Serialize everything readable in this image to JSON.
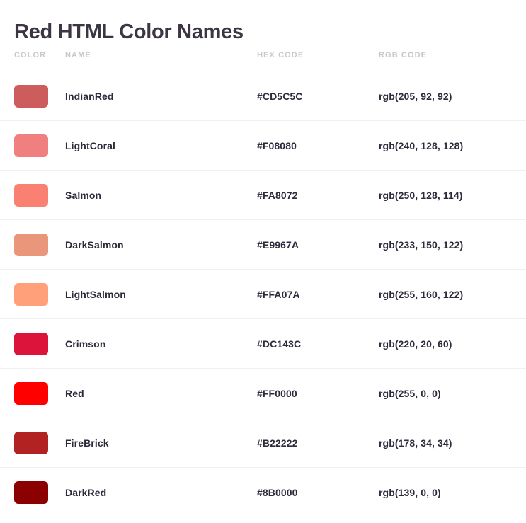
{
  "page": {
    "title": "Red HTML Color Names",
    "background": "#ffffff",
    "title_color": "#3b3544",
    "text_color": "#2b2b3c",
    "header_text_color": "#c7c7cd",
    "divider_color": "#eff0f1"
  },
  "table": {
    "columns": [
      {
        "key": "color",
        "label": "COLOR"
      },
      {
        "key": "name",
        "label": "NAME"
      },
      {
        "key": "hex",
        "label": "HEX CODE"
      },
      {
        "key": "rgb",
        "label": "RGB CODE"
      }
    ],
    "rows": [
      {
        "name": "IndianRed",
        "hex": "#CD5C5C",
        "rgb": "rgb(205, 92, 92)",
        "swatch": "#CD5C5C"
      },
      {
        "name": "LightCoral",
        "hex": "#F08080",
        "rgb": "rgb(240, 128, 128)",
        "swatch": "#F08080"
      },
      {
        "name": "Salmon",
        "hex": "#FA8072",
        "rgb": "rgb(250, 128, 114)",
        "swatch": "#FA8072"
      },
      {
        "name": "DarkSalmon",
        "hex": "#E9967A",
        "rgb": "rgb(233, 150, 122)",
        "swatch": "#E9967A"
      },
      {
        "name": "LightSalmon",
        "hex": "#FFA07A",
        "rgb": "rgb(255, 160, 122)",
        "swatch": "#FFA07A"
      },
      {
        "name": "Crimson",
        "hex": "#DC143C",
        "rgb": "rgb(220, 20, 60)",
        "swatch": "#DC143C"
      },
      {
        "name": "Red",
        "hex": "#FF0000",
        "rgb": "rgb(255, 0, 0)",
        "swatch": "#FF0000"
      },
      {
        "name": "FireBrick",
        "hex": "#B22222",
        "rgb": "rgb(178, 34, 34)",
        "swatch": "#B22222"
      },
      {
        "name": "DarkRed",
        "hex": "#8B0000",
        "rgb": "rgb(139, 0, 0)",
        "swatch": "#8B0000"
      }
    ]
  }
}
